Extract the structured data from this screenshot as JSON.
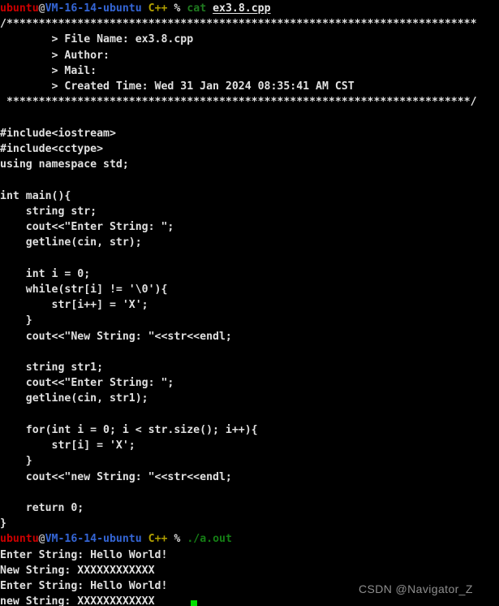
{
  "terminal": {
    "background_color": "#000000",
    "foreground_color": "#d8d8d8",
    "colors": {
      "user": "#cc0000",
      "at": "#b0b0b0",
      "host": "#3465d4",
      "lang": "#b2a000",
      "percent": "#d8d8d8",
      "command": "#1f7a1f",
      "filename": "#e6e6e6",
      "binary": "#157f15",
      "output": "#e0e0e0",
      "cursor": "#00e000",
      "watermark": "#8e8e8e"
    }
  },
  "prompt1": {
    "user": "ubuntu",
    "at": "@",
    "host": "VM-16-14-ubuntu",
    "lang": "C++",
    "percent": "%",
    "command": "cat",
    "argument": "ex3.8.cpp"
  },
  "prompt2": {
    "user": "ubuntu",
    "at": "@",
    "host": "VM-16-14-ubuntu",
    "lang": "C++",
    "percent": "%",
    "binary": "./a.out"
  },
  "file_header": {
    "open_line": "/*************************************************************************",
    "rows": [
      "        > File Name: ex3.8.cpp",
      "        > Author: ",
      "        > Mail: ",
      "        > Created Time: Wed 31 Jan 2024 08:35:41 AM CST"
    ],
    "close_line": " ************************************************************************/"
  },
  "source_code": [
    "",
    "#include<iostream>",
    "#include<cctype>",
    "using namespace std;",
    "",
    "int main(){",
    "    string str;",
    "    cout<<\"Enter String: \";",
    "    getline(cin, str);",
    "",
    "    int i = 0;",
    "    while(str[i] != '\\0'){",
    "        str[i++] = 'X';",
    "    }",
    "    cout<<\"New String: \"<<str<<endl;",
    "",
    "    string str1;",
    "    cout<<\"Enter String: \";",
    "    getline(cin, str1);",
    "",
    "    for(int i = 0; i < str.size(); i++){",
    "        str[i] = 'X';",
    "    }",
    "    cout<<\"new String: \"<<str<<endl;",
    "",
    "    return 0;",
    "}"
  ],
  "program_output": [
    "Enter String: Hello World!",
    "New String: XXXXXXXXXXXX",
    "Enter String: Hello World!",
    "new String: XXXXXXXXXXXX"
  ],
  "watermark": {
    "text": "CSDN @Navigator_Z"
  }
}
